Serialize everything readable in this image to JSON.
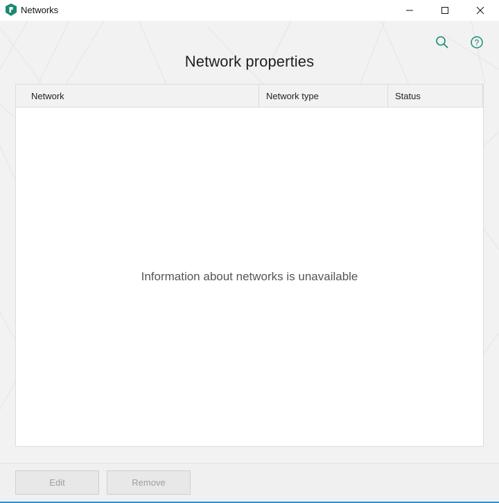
{
  "window": {
    "title": "Networks",
    "icon": "kaspersky-shield-icon",
    "controls": [
      "minimize-icon",
      "maximize-icon",
      "close-icon"
    ]
  },
  "header": {
    "title": "Network properties",
    "icons": [
      "search-icon",
      "help-icon"
    ],
    "accent_color": "#1a8a74"
  },
  "table": {
    "columns": [
      "Network",
      "Network type",
      "Status"
    ],
    "rows": [],
    "empty_message": "Information about networks is unavailable"
  },
  "footer": {
    "edit_label": "Edit",
    "remove_label": "Remove",
    "buttons_enabled": false
  }
}
